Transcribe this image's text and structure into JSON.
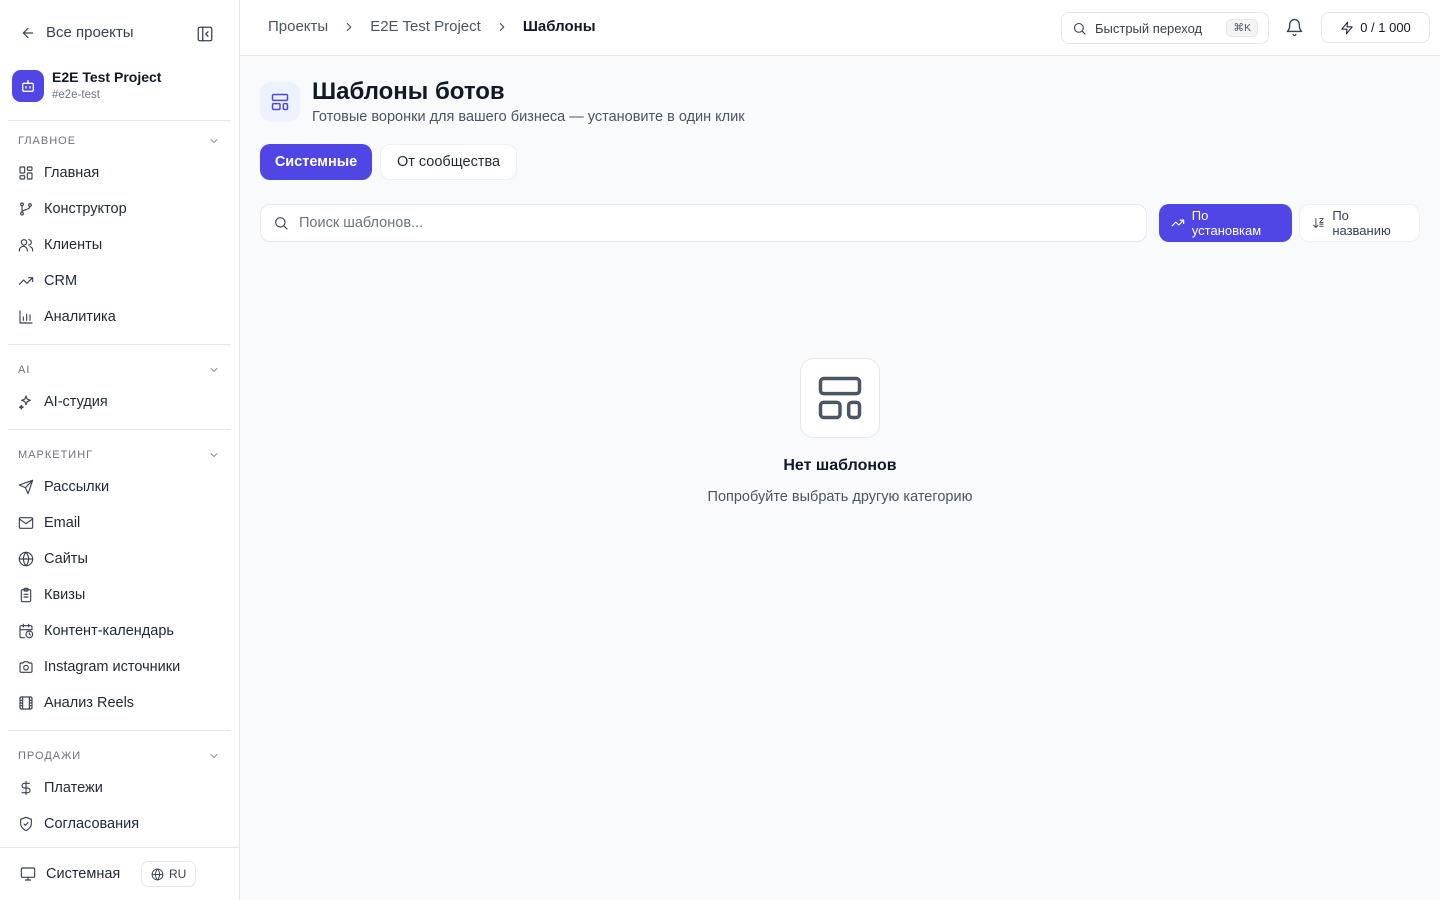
{
  "sidebar": {
    "back_label": "Все проекты",
    "project": {
      "name": "E2E Test Project",
      "slug": "#e2e-test"
    },
    "sections": [
      {
        "title": "Главное",
        "items": [
          "Главная",
          "Конструктор",
          "Клиенты",
          "CRM",
          "Аналитика"
        ]
      },
      {
        "title": "AI",
        "items": [
          "AI-студия"
        ]
      },
      {
        "title": "Маркетинг",
        "items": [
          "Рассылки",
          "Email",
          "Сайты",
          "Квизы",
          "Контент-календарь",
          "Instagram источники",
          "Анализ Reels"
        ]
      },
      {
        "title": "Продажи",
        "items": [
          "Платежи",
          "Согласования"
        ]
      }
    ],
    "footer": {
      "theme_label": "Системная",
      "lang_label": "RU"
    }
  },
  "topbar": {
    "breadcrumb": [
      "Проекты",
      "E2E Test Project",
      "Шаблоны"
    ],
    "quick_jump_label": "Быстрый переход",
    "quick_jump_shortcut": "⌘K",
    "credits": "0 / 1 000"
  },
  "main": {
    "title": "Шаблоны ботов",
    "subtitle": "Готовые воронки для вашего бизнеса — установите в один клик",
    "tabs": [
      "Системные",
      "От сообщества"
    ],
    "search_placeholder": "Поиск шаблонов...",
    "sort": {
      "installs": "По установкам",
      "name": "По названию"
    },
    "empty": {
      "title": "Нет шаблонов",
      "subtitle": "Попробуйте выбрать другую категорию"
    }
  },
  "colors": {
    "accent": "#4f46e5",
    "accent_soft": "#eef2ff",
    "border": "#e5e7eb",
    "background": "#f8fafc"
  },
  "icons": {
    "nav": [
      "layout-grid-icon",
      "git-branch-icon",
      "users-icon",
      "trending-up-icon",
      "bar-chart-icon",
      "sparkles-icon",
      "send-icon",
      "mail-icon",
      "globe-icon",
      "clipboard-list-icon",
      "calendar-clock-icon",
      "camera-icon",
      "film-icon",
      "dollar-icon",
      "shield-check-icon"
    ]
  }
}
